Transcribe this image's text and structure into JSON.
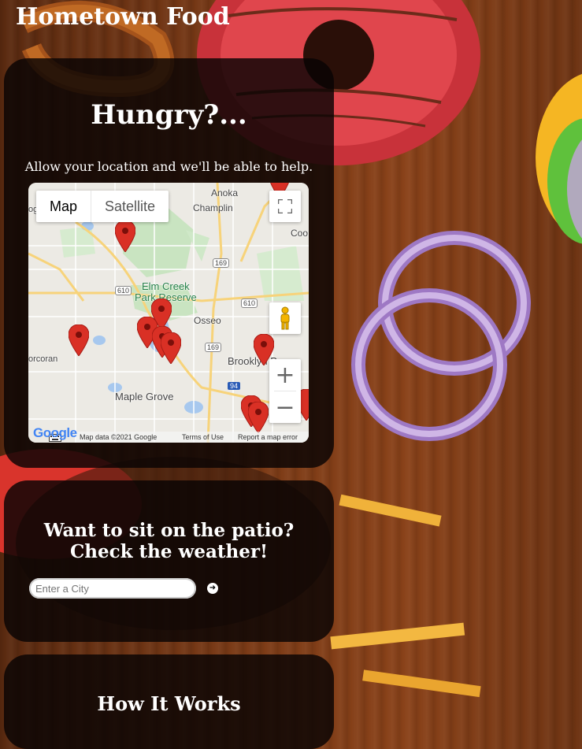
{
  "site": {
    "title": "Hometown Food"
  },
  "hungry": {
    "heading": "Hungry?...",
    "text": "Allow your location and we'll be able to help."
  },
  "map": {
    "type_controls": {
      "map": "Map",
      "satellite": "Satellite"
    },
    "labels": {
      "anoka": "Anoka",
      "champlin": "Champlin",
      "coo": "Coo",
      "elm_creek": "Elm Creek",
      "park_reserve": "Park Reserve",
      "osseo": "Osseo",
      "corcoran": "orcoran",
      "brooklyn": "Brooklyn P",
      "maple_grove": "Maple Grove",
      "hwy_169a": "169",
      "hwy_169b": "169",
      "hwy_610a": "610",
      "hwy_610b": "610",
      "i94": "94",
      "og": "og"
    },
    "attribution": {
      "logo": "Google",
      "data": "Map data ©2021 Google",
      "terms": "Terms of Use",
      "report": "Report a map error"
    },
    "zoom_in": "+",
    "zoom_out": "−",
    "icons": {
      "fullscreen": "fullscreen-icon",
      "pegman": "pegman-icon",
      "keyboard": "keyboard-icon",
      "marker": "map-marker-icon"
    },
    "marker_color": "#d93025"
  },
  "weather": {
    "heading_line1": "Want to sit on the patio?",
    "heading_line2": "Check the weather!",
    "city_placeholder": "Enter a City",
    "go_icon": "➜"
  },
  "how": {
    "heading": "How It Works"
  },
  "colors": {
    "panel_bg": "#080404",
    "title_text": "#ffffff",
    "wood": "#7a3a16"
  }
}
